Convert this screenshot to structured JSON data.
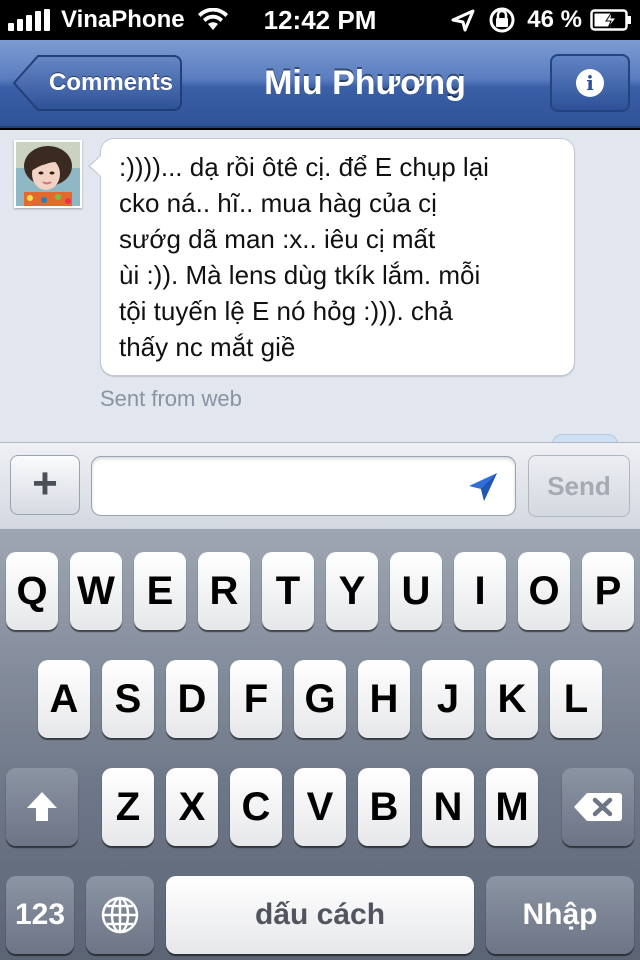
{
  "status_bar": {
    "carrier": "VinaPhone",
    "time": "12:42 PM",
    "battery_percent": "46 %",
    "icons": [
      "signal-icon",
      "wifi-icon",
      "location-arrow-icon",
      "rotation-lock-icon",
      "battery-icon"
    ]
  },
  "nav": {
    "back_label": "Comments",
    "title": "Miu Phương",
    "info_icon": "info-icon",
    "info_glyph": "i"
  },
  "conversation": {
    "message": ":))))... dạ rồi ôtê cị. để E chụp lại\ncko ná.. hĩ.. mua hàg của cị\nsướg dã man :x.. iêu cị mất\nùi :)). Mà lens dùg tkík lắm. mỗi\ntội tuyến lệ E nó hỏg :))). chả\nthấy nc mắt giề",
    "sent_from": "Sent from web"
  },
  "compose": {
    "plus_label": "+",
    "input_value": "",
    "send_label": "Send"
  },
  "keyboard": {
    "row1": [
      "Q",
      "W",
      "E",
      "R",
      "T",
      "Y",
      "U",
      "I",
      "O",
      "P"
    ],
    "row2": [
      "A",
      "S",
      "D",
      "F",
      "G",
      "H",
      "J",
      "K",
      "L"
    ],
    "row3": [
      "Z",
      "X",
      "C",
      "V",
      "B",
      "N",
      "M"
    ],
    "numbers_label": "123",
    "space_label": "dấu cách",
    "return_label": "Nhập"
  },
  "colors": {
    "nav_blue": "#3b5fa6",
    "conversation_bg": "#e1e6ef",
    "location_arrow": "#2f6fd6"
  }
}
